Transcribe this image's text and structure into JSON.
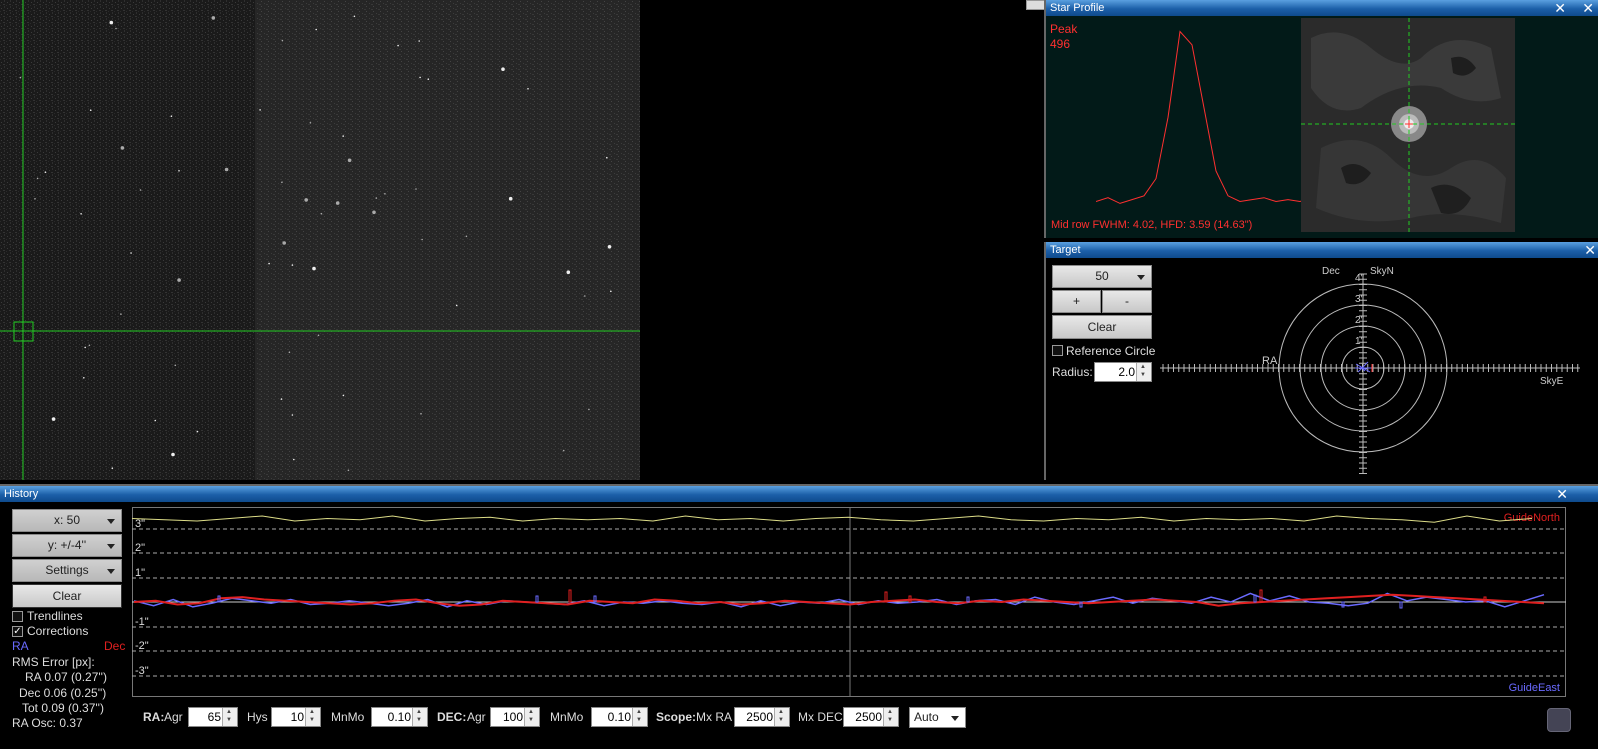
{
  "star_profile": {
    "title": "Star Profile",
    "peak_label": "Peak",
    "peak_value": "496",
    "fwhm_text": "Mid row FWHM: 4.02, HFD: 3.59 (14.63\")",
    "profile_values": [
      0.06,
      0.08,
      0.05,
      0.07,
      0.09,
      0.18,
      0.5,
      0.95,
      0.88,
      0.55,
      0.22,
      0.09,
      0.06,
      0.07,
      0.08,
      0.06,
      0.07,
      0.06,
      0.08,
      0.06,
      0.04
    ]
  },
  "target": {
    "title": "Target",
    "zoom_value": "50",
    "plus_label": "+",
    "minus_label": "-",
    "clear_label": "Clear",
    "reference_circle_label": "Reference Circle",
    "radius_label": "Radius:",
    "radius_value": "2.0",
    "dec_label": "Dec",
    "skyn_label": "SkyN",
    "ra_label": "RA",
    "skye_label": "SkyE",
    "ring_labels": [
      "4\"",
      "3\"",
      "2\"",
      "1\""
    ]
  },
  "history": {
    "title": "History",
    "x_dropdown": "x:  50",
    "y_dropdown": "y: +/-4''",
    "settings_label": "Settings",
    "clear_label": "Clear",
    "trendlines_label": "Trendlines",
    "trendlines_checked": false,
    "corrections_label": "Corrections",
    "corrections_checked": true,
    "ra_legend": "RA",
    "dec_legend": "Dec",
    "rms_title": "RMS Error [px]:",
    "rms_ra": "RA 0.07 (0.27'')",
    "rms_dec": "Dec 0.06 (0.25'')",
    "rms_tot": "Tot 0.09 (0.37'')",
    "ra_osc": "RA Osc: 0.37",
    "y_labels": [
      "3\"",
      "2\"",
      "1\"",
      "-1\"",
      "-2\"",
      "-3\""
    ],
    "guide_north": "GuideNorth",
    "guide_east": "GuideEast",
    "ra_series": [
      0.05,
      -0.15,
      0.1,
      -0.2,
      -0.05,
      0.15,
      0.05,
      -0.05,
      0.1,
      -0.1,
      -0.05,
      0.05,
      -0.05,
      -0.15,
      -0.05,
      0.1,
      -0.2,
      0.05,
      -0.1,
      0.05,
      0.0,
      -0.05,
      -0.1,
      0.05,
      -0.15,
      0.0,
      -0.05,
      0.05,
      -0.05,
      -0.1,
      0.0,
      -0.2,
      0.05,
      -0.15,
      0.0,
      -0.05,
      0.1,
      -0.1,
      0.05,
      -0.05,
      0.0,
      0.1,
      -0.1,
      0.05,
      0.1,
      -0.1,
      0.2,
      0.0,
      -0.1,
      0.05,
      0.2,
      -0.05,
      0.15,
      0.05,
      -0.05,
      0.2,
      0.0,
      0.35,
      0.05,
      0.25,
      0.0,
      -0.05,
      -0.15,
      -0.05,
      0.35,
      0.05,
      0.2,
      0.1,
      0.0,
      0.05,
      -0.2,
      0.05,
      0.3
    ],
    "dec_series": [
      0.0,
      0.05,
      -0.1,
      -0.05,
      0.15,
      0.2,
      0.1,
      0.05,
      0.0,
      -0.05,
      -0.1,
      -0.05,
      0.05,
      0.1,
      -0.05,
      -0.15,
      -0.1,
      0.05,
      0.0,
      -0.05,
      -0.1,
      0.05,
      0.0,
      -0.05,
      0.1,
      0.05,
      -0.05,
      0.0,
      -0.1,
      -0.05,
      0.05,
      0.0,
      -0.05,
      -0.1,
      0.0,
      0.05,
      0.1,
      0.0,
      -0.05,
      0.05,
      0.0,
      0.1,
      0.05,
      0.0,
      -0.05,
      0.0,
      0.05,
      0.1,
      0.05,
      0.0,
      -0.15,
      -0.05,
      0.0,
      0.05,
      0.1,
      0.15,
      0.2,
      0.25,
      0.3,
      0.25,
      0.2,
      0.15,
      0.1,
      0.05,
      0.0,
      -0.05
    ],
    "snr_series": [
      0.3,
      0.35,
      0.4,
      0.3,
      0.2,
      0.4,
      0.3,
      0.35,
      0.2,
      0.4,
      0.3,
      0.25,
      0.4,
      0.3,
      0.35,
      0.3,
      0.4,
      0.2,
      0.35,
      0.3,
      0.4,
      0.3,
      0.25,
      0.35,
      0.4,
      0.3,
      0.2,
      0.35,
      0.4,
      0.3,
      0.35,
      0.25,
      0.4,
      0.3,
      0.35,
      0.3,
      0.4,
      0.2,
      0.3,
      0.35,
      0.45,
      0.2,
      0.4,
      0.3
    ]
  },
  "controls": {
    "ra_label": "RA:",
    "ra_agr_label": "Agr",
    "ra_agr_value": "65",
    "hys_label": "Hys",
    "hys_value": "10",
    "ra_mnmo_label": "MnMo",
    "ra_mnmo_value": "0.10",
    "dec_label": "DEC:",
    "dec_agr_label": "Agr",
    "dec_agr_value": "100",
    "dec_mnmo_label": "MnMo",
    "dec_mnmo_value": "0.10",
    "scope_label": "Scope:",
    "mx_ra_label": "Mx RA",
    "mx_ra_value": "2500",
    "mx_dec_label": "Mx DEC",
    "mx_dec_value": "2500",
    "mode_value": "Auto"
  },
  "colors": {
    "ra": "#6a6aff",
    "dec": "#e02020",
    "crosshair": "#22cc22",
    "title_bar": "#1c5fa8",
    "profile": "#ff3030"
  }
}
